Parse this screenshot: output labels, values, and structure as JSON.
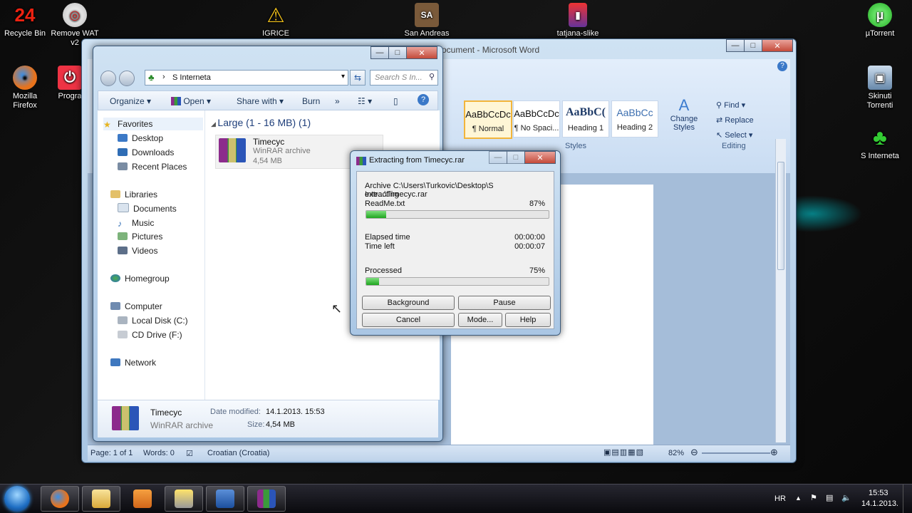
{
  "desktop": {
    "icons": [
      {
        "label": "Recycle Bin",
        "glyph": "24"
      },
      {
        "label": "Remove WAT v2",
        "glyph": "◎"
      },
      {
        "label": "IGRICE",
        "glyph": "⚠"
      },
      {
        "label": "San Andreas",
        "glyph": "SA"
      },
      {
        "label": "tatjana-slike",
        "glyph": "▮"
      },
      {
        "label": "µTorrent",
        "glyph": "µ"
      },
      {
        "label": "Mozilla Firefox",
        "glyph": "●"
      },
      {
        "label": "Progra",
        "glyph": "⏻"
      },
      {
        "label": "Skinuti Torrenti",
        "glyph": "▣"
      },
      {
        "label": "S Interneta",
        "glyph": "♣"
      }
    ]
  },
  "word": {
    "title": "ocument - Microsoft Word",
    "styles": [
      {
        "sample": "AaBbCcDc",
        "name": "¶ Normal"
      },
      {
        "sample": "AaBbCcDc",
        "name": "¶ No Spaci..."
      },
      {
        "sample": "AaBbC(",
        "name": "Heading 1"
      },
      {
        "sample": "AaBbCc",
        "name": "Heading 2"
      }
    ],
    "change_styles": "Change Styles",
    "styles_group": "Styles",
    "editing_group": "Editing",
    "find": "Find",
    "replace": "Replace",
    "select": "Select",
    "status": {
      "page": "Page: 1 of 1",
      "words": "Words: 0",
      "language": "Croatian (Croatia)",
      "zoom": "82%"
    }
  },
  "explorer": {
    "address": "S Interneta",
    "search_placeholder": "Search S In...",
    "toolbar": {
      "organize": "Organize",
      "open": "Open",
      "share": "Share with",
      "burn": "Burn",
      "more": "»"
    },
    "nav": {
      "favorites": "Favorites",
      "desktop": "Desktop",
      "downloads": "Downloads",
      "recent": "Recent Places",
      "libraries": "Libraries",
      "documents": "Documents",
      "music": "Music",
      "pictures": "Pictures",
      "videos": "Videos",
      "homegroup": "Homegroup",
      "computer": "Computer",
      "local_disk": "Local Disk (C:)",
      "cd_drive": "CD Drive (F:)",
      "network": "Network"
    },
    "group_header": "Large (1 - 16 MB) (1)",
    "file": {
      "name": "Timecyc",
      "type": "WinRAR archive",
      "size": "4,54 MB"
    },
    "details": {
      "name": "Timecyc",
      "type": "WinRAR archive",
      "date_label": "Date modified:",
      "date": "14.1.2013. 15:53",
      "size_label": "Size:",
      "size": "4,54 MB"
    }
  },
  "rar": {
    "title": "Extracting from Timecyc.rar",
    "archive": "Archive C:\\Users\\Turkovic\\Desktop\\S Inte...\\Timecyc.rar",
    "action": "extracting",
    "file": "ReadMe.txt",
    "file_pct": "87%",
    "file_progress": 0.11,
    "elapsed_label": "Elapsed time",
    "elapsed": "00:00:00",
    "left_label": "Time left",
    "left": "00:00:07",
    "processed_label": "Processed",
    "processed_pct": "75%",
    "processed_progress": 0.07,
    "buttons": {
      "background": "Background",
      "pause": "Pause",
      "cancel": "Cancel",
      "mode": "Mode...",
      "help": "Help"
    }
  },
  "taskbar": {
    "lang": "HR",
    "time": "15:53",
    "date": "14.1.2013."
  }
}
